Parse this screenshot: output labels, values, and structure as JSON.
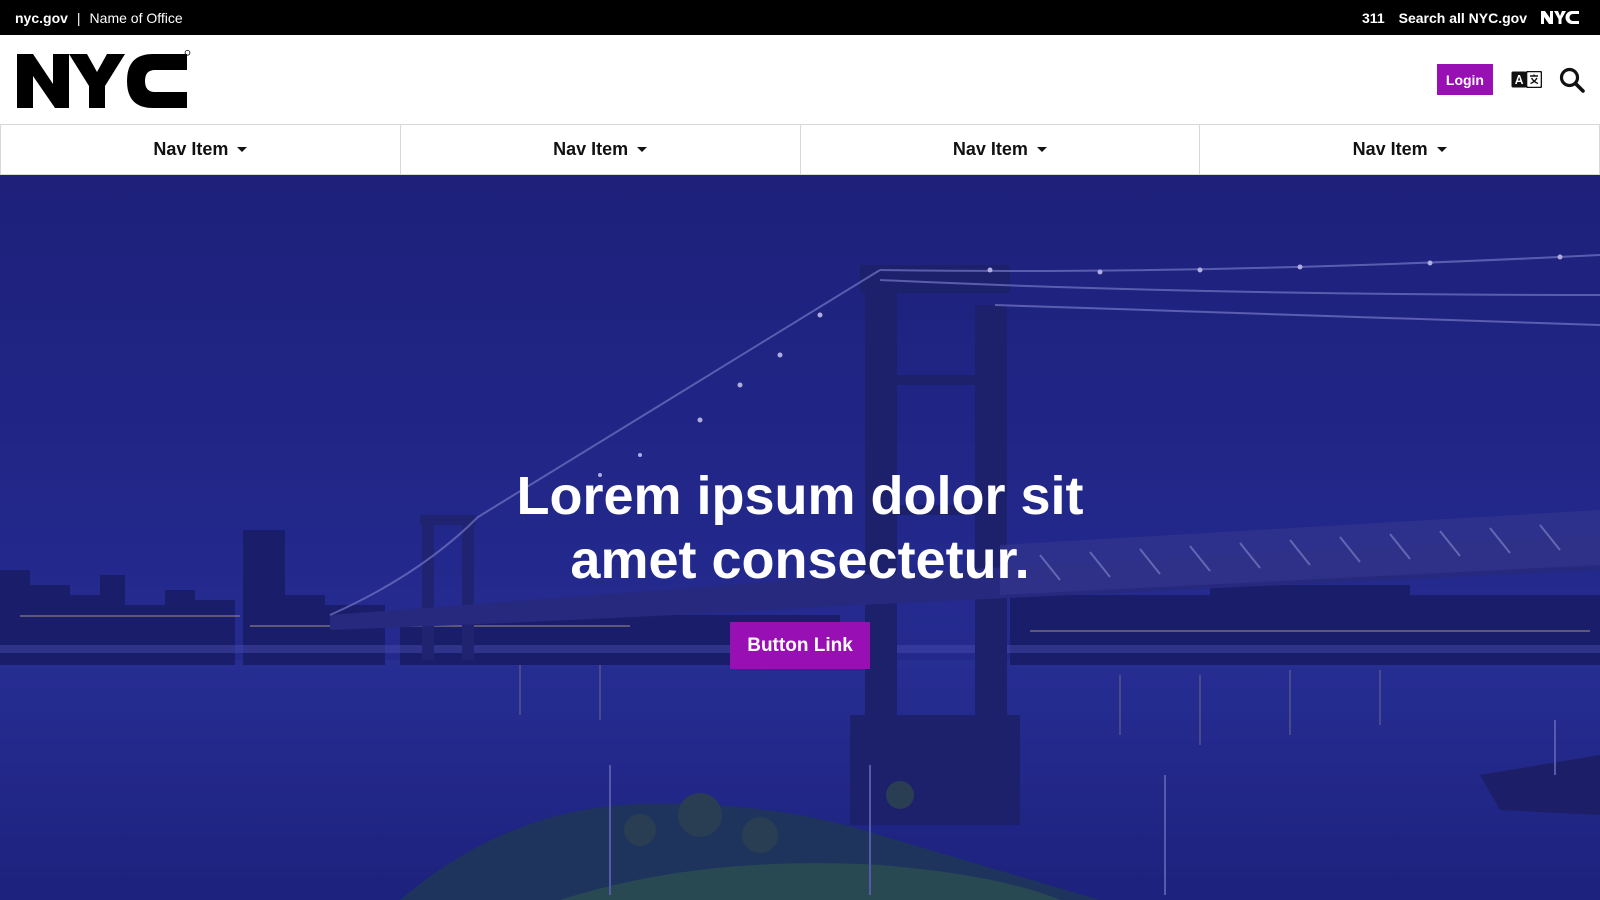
{
  "topbar": {
    "site_link": "nyc.gov",
    "separator": "|",
    "office_name": "Name of Office",
    "phone_link": "311",
    "search_link": "Search all NYC.gov",
    "logo_text": "NYC"
  },
  "header": {
    "logo_text": "NYC",
    "logo_mark": "®",
    "login_label": "Login",
    "translate_icon": "translate-icon",
    "search_icon": "search-icon"
  },
  "nav": {
    "items": [
      {
        "label": "Nav Item"
      },
      {
        "label": "Nav Item"
      },
      {
        "label": "Nav Item"
      },
      {
        "label": "Nav Item"
      }
    ]
  },
  "hero": {
    "title": "Lorem ipsum dolor sit amet consectetur.",
    "button_label": "Button Link"
  },
  "colors": {
    "accent": "#9810b3",
    "topbar_bg": "#000000",
    "hero_tint": "#232a86"
  }
}
